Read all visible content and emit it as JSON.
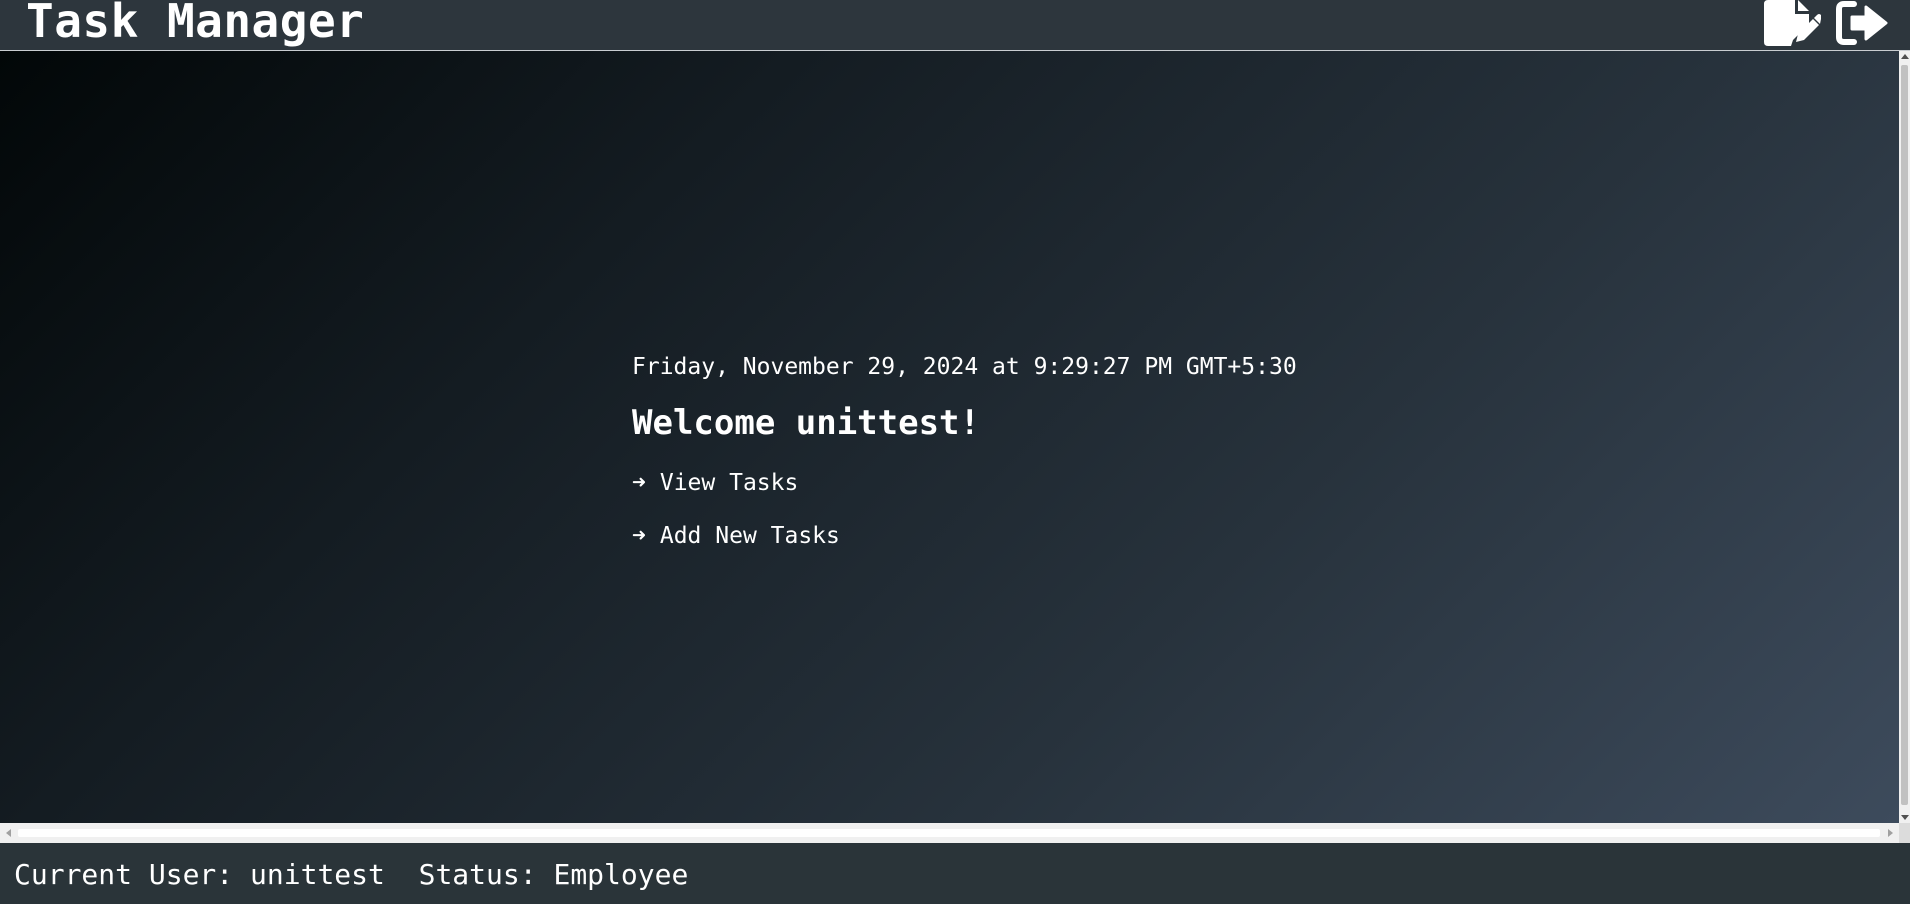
{
  "header": {
    "title": "Task Manager",
    "icons": {
      "edit": "file-edit-icon",
      "logout": "sign-out-icon"
    }
  },
  "main": {
    "datetime": "Friday, November 29, 2024 at 9:29:27 PM GMT+5:30",
    "welcome_prefix": "Welcome ",
    "username": "unittest",
    "welcome_suffix": "!",
    "links": [
      {
        "arrow": "➜",
        "label": "View Tasks"
      },
      {
        "arrow": "➜",
        "label": "Add New Tasks"
      }
    ]
  },
  "footer": {
    "current_user_label": "Current User:",
    "current_user_value": "unittest",
    "status_label": "Status:",
    "status_value": "Employee"
  },
  "colors": {
    "header_bg": "#2d363d",
    "footer_bg": "#2a3439",
    "text": "#ffffff",
    "gradient_start": "#020708",
    "gradient_end": "#3d4b5c"
  }
}
